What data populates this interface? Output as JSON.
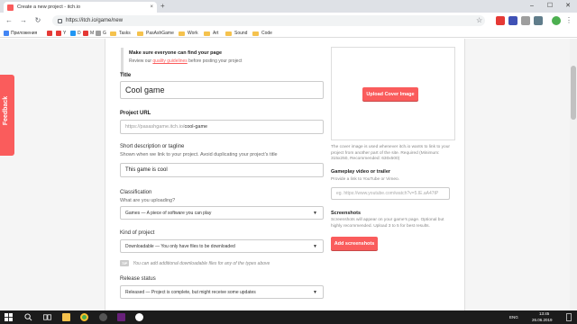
{
  "browser": {
    "tab_title": "Create a new project - itch.io",
    "tab_close": "×",
    "new_tab": "+",
    "url": "https://itch.io/game/new",
    "minimize": "–",
    "maximize": "☐",
    "close": "✕",
    "back": "←",
    "forward": "→",
    "reload": "↻",
    "star": "☆",
    "menu": "⋮"
  },
  "bookmarks": [
    {
      "label": "Приложения",
      "color": "#4285f4"
    },
    {
      "label": "",
      "color": "#e53935"
    },
    {
      "label": "Y",
      "color": "#e53935"
    },
    {
      "label": "D",
      "color": "#2196f3"
    },
    {
      "label": "M",
      "color": "#e53935"
    },
    {
      "label": "G",
      "color": "#9e9e9e"
    }
  ],
  "bookmark_folders": [
    "Tasks",
    "PasAshGame",
    "Work",
    "Art",
    "Sound",
    "Code"
  ],
  "feedback": "Feedback",
  "notice": {
    "title": "Make sure everyone can find your page",
    "text_before": "Review our ",
    "link": "quality guidelines",
    "text_after": " before posting your project"
  },
  "form": {
    "title_label": "Title",
    "title_value": "Cool game",
    "url_label": "Project URL",
    "url_prefix": "https://pasashgame.itch.io/",
    "url_slug": "cool-game",
    "short_desc_label": "Short description or tagline",
    "short_desc_hint": "Shown when we link to your project. Avoid duplicating your project's title",
    "short_desc_value": "This game is cool",
    "classification_label": "Classification",
    "classification_hint": "What are you uploading?",
    "classification_value": "Games — A piece of software you can play",
    "kind_label": "Kind of project",
    "kind_value": "Downloadable — You only have files to be downloaded",
    "tip_badge": "TIP",
    "tip_text": "You can add additional downloadable files for any of the types above",
    "release_label": "Release status",
    "release_value": "Released — Project is complete, but might receive some updates"
  },
  "side": {
    "upload_cover": "Upload Cover Image",
    "cover_hint": "The cover image is used whenever itch.io wants to link to your project from another part of the site. Required (Minimum: 315x250, Recommended: 630x500)",
    "video_label": "Gameplay video or trailer",
    "video_hint": "Provide a link to YouTube or Vimeo.",
    "video_placeholder": "eg. https://www.youtube.com/watch?v=5.IE.aA47tP",
    "screenshots_label": "Screenshots",
    "screenshots_hint": "Screenshots will appear on your game's page. Optional but highly recommended. Upload 3 to 5 for best results.",
    "add_screenshots": "Add screenshots"
  },
  "taskbar": {
    "lang": "ENG",
    "time": "13:45",
    "date": "26.06.2019"
  },
  "colors": {
    "accent": "#fa5c5c",
    "taskbar": "#1c1c1c"
  }
}
